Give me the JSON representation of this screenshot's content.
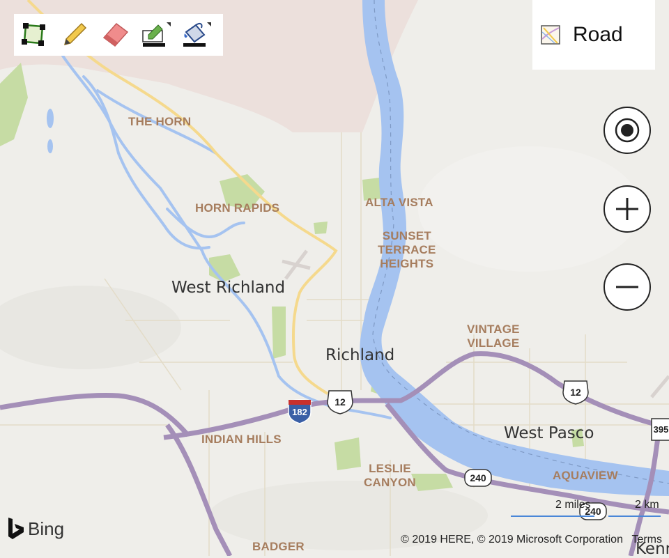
{
  "map": {
    "neighborhoods": [
      {
        "id": "the-horn",
        "text": "THE HORN"
      },
      {
        "id": "horn-rapids",
        "text": "HORN RAPIDS"
      },
      {
        "id": "alta-vista",
        "text": "ALTA VISTA"
      },
      {
        "id": "sunset-terrace-heights",
        "text": "SUNSET\nTERRACE\nHEIGHTS"
      },
      {
        "id": "vintage-village",
        "text": "VINTAGE\nVILLAGE"
      },
      {
        "id": "indian-hills",
        "text": "INDIAN HILLS"
      },
      {
        "id": "leslie-canyon",
        "text": "LESLIE\nCANYON"
      },
      {
        "id": "aquaview",
        "text": "AQUAVIEW"
      },
      {
        "id": "badger",
        "text": "BADGER"
      }
    ],
    "cities": {
      "west_richland": "West Richland",
      "richland": "Richland",
      "west_pasco": "West Pasco",
      "kennewick_partial": "Kenn"
    },
    "shields": {
      "us12_a": "12",
      "us12_b": "12",
      "i182": "182",
      "sr240_a": "240",
      "sr240_b": "240",
      "us395": "395"
    }
  },
  "toolbar": {
    "tools": [
      "draw-polygon-icon",
      "pencil-icon",
      "eraser-icon",
      "edit-style-icon",
      "paint-bucket-icon"
    ]
  },
  "style_picker": {
    "label": "Road",
    "icon": "road-map-icon"
  },
  "controls": [
    "locate-me-icon",
    "zoom-in-icon",
    "zoom-out-icon"
  ],
  "scale": {
    "miles": "2 miles",
    "km": "2 km"
  },
  "attribution": {
    "text": "© 2019 HERE, © 2019 Microsoft Corporation",
    "terms": "Terms"
  },
  "brand": {
    "name": "Bing"
  },
  "colors": {
    "land": "#efeeea",
    "water": "#a5c3f0",
    "highway": "#a48fb8",
    "arterial": "#f5d98d",
    "park": "#c6dca4",
    "hanford": "#ece0dc",
    "place_label": "#a67d5e"
  }
}
